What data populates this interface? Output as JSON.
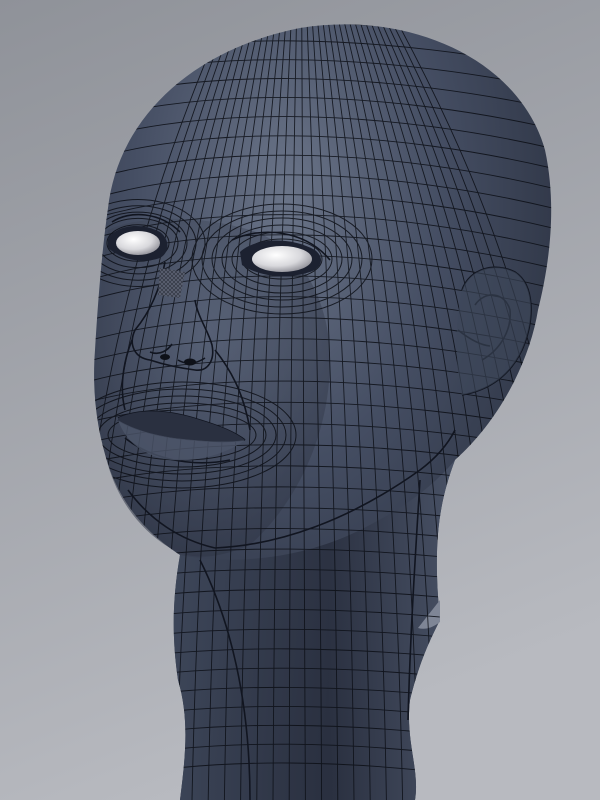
{
  "scene": {
    "subject": "head-mesh",
    "render_mode": "wireframe-on-shaded",
    "colors": {
      "background_top": "#8f9299",
      "background_bottom": "#b8bac0",
      "mesh_base": "#3c4558",
      "mesh_highlight": "#6a7488",
      "mesh_shadow": "#1e2330",
      "wire": "#0c0f16",
      "eye": "#f2f2f2",
      "eye_shade": "#9a9aa0"
    }
  }
}
